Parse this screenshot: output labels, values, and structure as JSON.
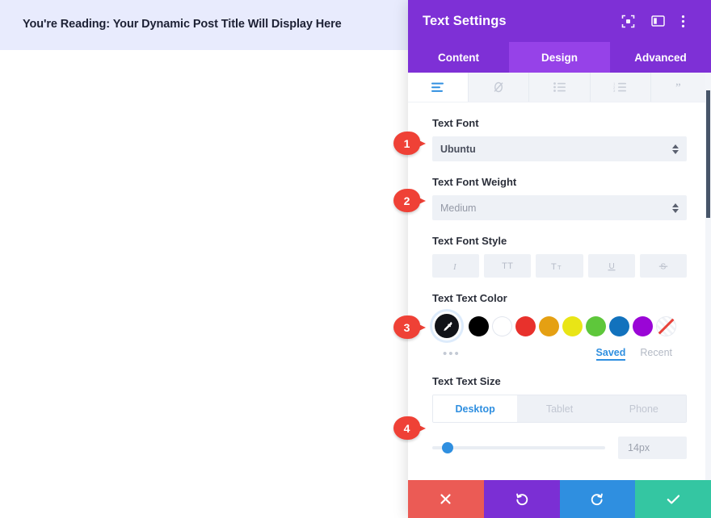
{
  "preview": {
    "banner_text": "You're Reading: Your Dynamic Post Title Will Display Here"
  },
  "modal": {
    "title": "Text Settings",
    "header_icons": [
      {
        "name": "focus-expand-icon"
      },
      {
        "name": "layout-columns-icon"
      },
      {
        "name": "more-vertical-icon"
      }
    ],
    "tabs": [
      {
        "label": "Content",
        "active": false
      },
      {
        "label": "Design",
        "active": true
      },
      {
        "label": "Advanced",
        "active": false
      }
    ],
    "format_toolbar": [
      {
        "name": "align-paragraph-icon",
        "active": true
      },
      {
        "name": "link-break-icon",
        "active": false
      },
      {
        "name": "bulleted-list-icon",
        "active": false
      },
      {
        "name": "numbered-list-icon",
        "active": false
      },
      {
        "name": "blockquote-icon",
        "active": false
      }
    ],
    "font": {
      "label": "Text Font",
      "value": "Ubuntu"
    },
    "font_weight": {
      "label": "Text Font Weight",
      "value": "Medium"
    },
    "font_style": {
      "label": "Text Font Style",
      "buttons": [
        {
          "name": "italic-icon",
          "glyph": "I"
        },
        {
          "name": "uppercase-icon",
          "glyph": "TT"
        },
        {
          "name": "small-caps-icon",
          "glyph": "Tт"
        },
        {
          "name": "underline-icon",
          "glyph": "U"
        },
        {
          "name": "strikethrough-icon",
          "glyph": "S"
        }
      ]
    },
    "text_color": {
      "label": "Text Text Color",
      "picker_name": "eyedropper-icon",
      "swatches": [
        {
          "name": "swatch-black",
          "hex": "#000000"
        },
        {
          "name": "swatch-white",
          "hex": "#ffffff"
        },
        {
          "name": "swatch-red",
          "hex": "#e8312c"
        },
        {
          "name": "swatch-orange",
          "hex": "#e5a013"
        },
        {
          "name": "swatch-yellow",
          "hex": "#e9e516"
        },
        {
          "name": "swatch-green",
          "hex": "#5ec73b"
        },
        {
          "name": "swatch-blue",
          "hex": "#1272bd"
        },
        {
          "name": "swatch-purple",
          "hex": "#9a06d6"
        },
        {
          "name": "swatch-transparent",
          "hex": "transparent"
        }
      ],
      "more_dots": "•••",
      "saved_label": "Saved",
      "recent_label": "Recent"
    },
    "text_size": {
      "label": "Text Text Size",
      "devices": [
        {
          "label": "Desktop",
          "active": true
        },
        {
          "label": "Tablet",
          "active": false
        },
        {
          "label": "Phone",
          "active": false
        }
      ],
      "value": "14px",
      "slider_percent": 9
    },
    "actions": [
      {
        "name": "cancel-button",
        "icon": "close-icon",
        "color": "#eb5b55"
      },
      {
        "name": "undo-button",
        "icon": "undo-icon",
        "color": "#7b2fd4"
      },
      {
        "name": "redo-button",
        "icon": "redo-icon",
        "color": "#2f8fe0"
      },
      {
        "name": "save-button",
        "icon": "checkmark-icon",
        "color": "#34c6a2"
      }
    ]
  },
  "callouts": [
    {
      "number": "1"
    },
    {
      "number": "2"
    },
    {
      "number": "3"
    },
    {
      "number": "4"
    }
  ]
}
